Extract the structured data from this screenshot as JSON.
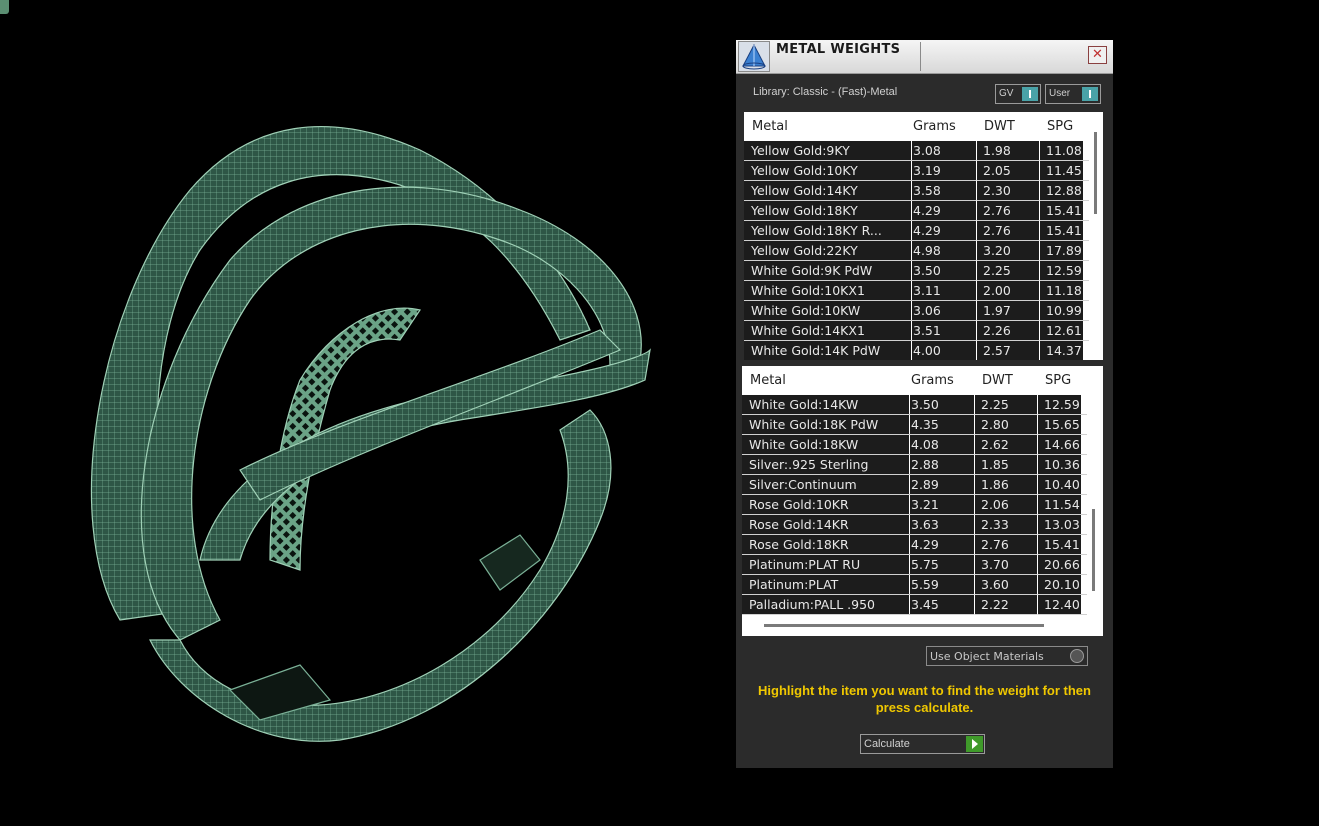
{
  "window": {
    "title": "METAL WEIGHTS",
    "close_symbol": "✕"
  },
  "library": {
    "label": "Library: Classic - (Fast)-Metal"
  },
  "toggles": {
    "gv": "GV",
    "user": "User"
  },
  "columns": [
    "Metal",
    "Grams",
    "DWT",
    "SPG"
  ],
  "table_top": [
    [
      "Yellow Gold:9KY",
      "3.08",
      "1.98",
      "11.08"
    ],
    [
      "Yellow Gold:10KY",
      "3.19",
      "2.05",
      "11.45"
    ],
    [
      "Yellow Gold:14KY",
      "3.58",
      "2.30",
      "12.88"
    ],
    [
      "Yellow Gold:18KY",
      "4.29",
      "2.76",
      "15.41"
    ],
    [
      "Yellow Gold:18KY R...",
      "4.29",
      "2.76",
      "15.41"
    ],
    [
      "Yellow Gold:22KY",
      "4.98",
      "3.20",
      "17.89"
    ],
    [
      "White Gold:9K PdW",
      "3.50",
      "2.25",
      "12.59"
    ],
    [
      "White Gold:10KX1",
      "3.11",
      "2.00",
      "11.18"
    ],
    [
      "White Gold:10KW",
      "3.06",
      "1.97",
      "10.99"
    ],
    [
      "White Gold:14KX1",
      "3.51",
      "2.26",
      "12.61"
    ],
    [
      "White Gold:14K PdW",
      "4.00",
      "2.57",
      "14.37"
    ]
  ],
  "table_bottom": [
    [
      "White Gold:14KW",
      "3.50",
      "2.25",
      "12.59"
    ],
    [
      "White Gold:18K PdW",
      "4.35",
      "2.80",
      "15.65"
    ],
    [
      "White Gold:18KW",
      "4.08",
      "2.62",
      "14.66"
    ],
    [
      "Silver:.925 Sterling",
      "2.88",
      "1.85",
      "10.36"
    ],
    [
      "Silver:Continuum",
      "2.89",
      "1.86",
      "10.40"
    ],
    [
      "Rose Gold:10KR",
      "3.21",
      "2.06",
      "11.54"
    ],
    [
      "Rose Gold:14KR",
      "3.63",
      "2.33",
      "13.03"
    ],
    [
      "Rose Gold:18KR",
      "4.29",
      "2.76",
      "15.41"
    ],
    [
      "Platinum:PLAT RU",
      "5.75",
      "3.70",
      "20.66"
    ],
    [
      "Platinum:PLAT",
      "5.59",
      "3.60",
      "20.10"
    ],
    [
      "Palladium:PALL .950",
      "3.45",
      "2.22",
      "12.40"
    ]
  ],
  "use_object_materials": {
    "label": "Use Object Materials"
  },
  "instruction": "Highlight the item you want to find the weight for then press calculate.",
  "calculate": {
    "label": "Calculate"
  },
  "colors": {
    "wireframe": "#5f9a7e",
    "ring_surface": "#2e5646",
    "panel": "#2b2b2b",
    "accent": "#4aa3a8",
    "instruction": "#f0c800"
  }
}
